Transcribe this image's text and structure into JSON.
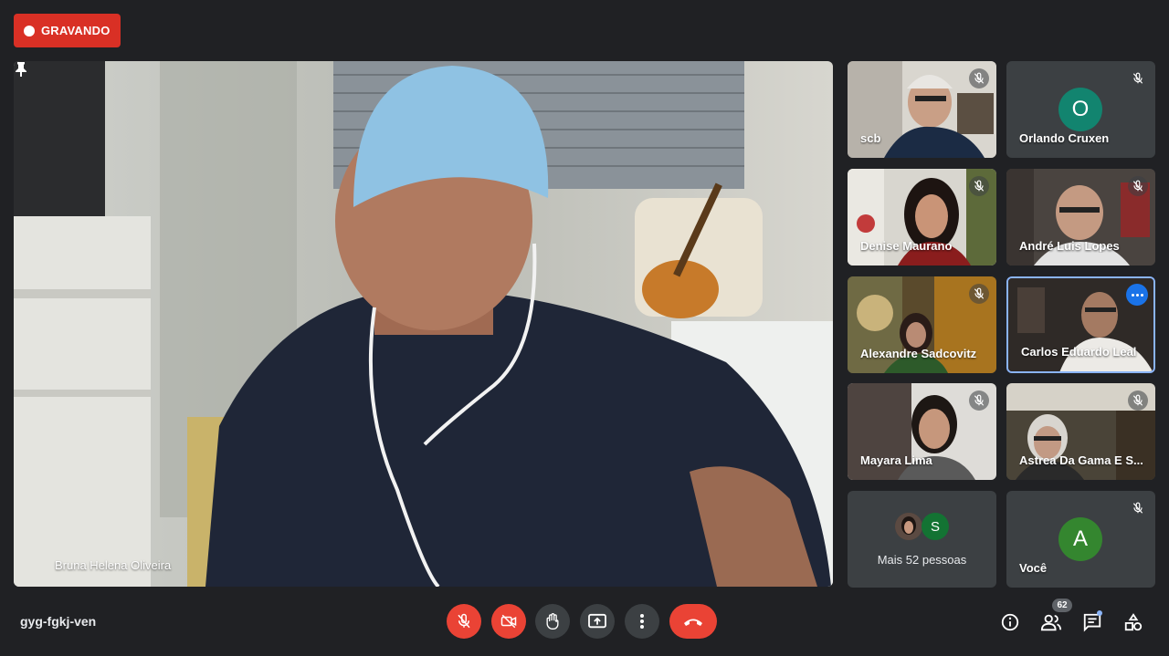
{
  "recording": {
    "label": "GRAVANDO"
  },
  "stage": {
    "pinned_name": "Bruna Helena Oliveira"
  },
  "tiles": [
    {
      "name": "scb"
    },
    {
      "name": "Orlando Cruxen",
      "avatar_letter": "O",
      "avatar_color": "#12846f"
    },
    {
      "name": "Denise Maurano"
    },
    {
      "name": "André Luis Lopes"
    },
    {
      "name": "Alexandre Sadcovitz"
    },
    {
      "name": "Carlos Eduardo Leal"
    },
    {
      "name": "Mayara Lima"
    },
    {
      "name": "Astrea Da Gama E S..."
    },
    {
      "more_label": "Mais 52 pessoas",
      "mini_avatar_letter": "S",
      "mini_avatar_color": "#137333"
    },
    {
      "name": "Você",
      "avatar_letter": "A",
      "avatar_color": "#34862f"
    }
  ],
  "bottom_bar": {
    "meeting_code": "gyg-fgkj-ven",
    "participants_count": "62",
    "icons": [
      "mic-off-icon",
      "camera-off-icon",
      "raise-hand-icon",
      "present-screen-icon",
      "more-options-icon",
      "end-call-icon",
      "info-icon",
      "people-icon",
      "chat-icon",
      "activities-icon"
    ]
  },
  "colors": {
    "accent": "#8ab4f8",
    "danger": "#ea4335",
    "background": "#202124"
  }
}
